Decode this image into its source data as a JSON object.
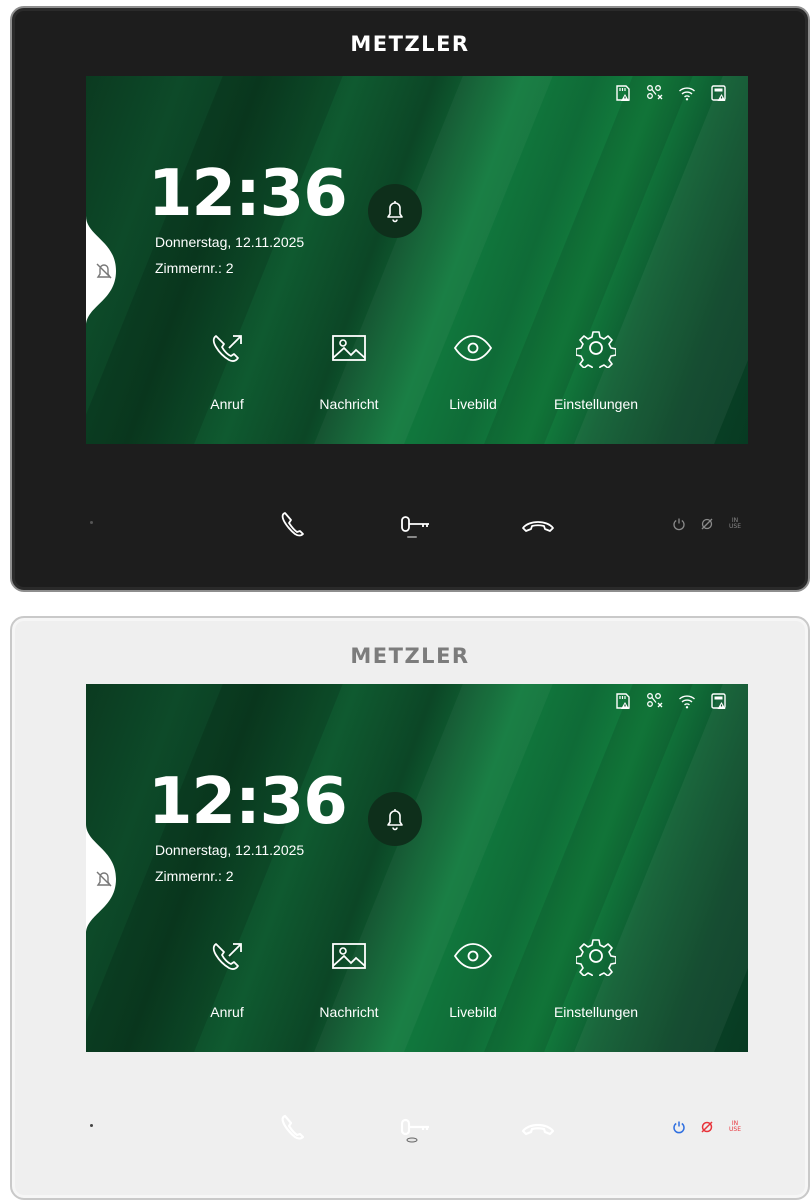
{
  "brand": "METZLER",
  "screen": {
    "time": "12:36",
    "date": "Donnerstag, 12.11.2025",
    "room": "Zimmernr.: 2",
    "status_icons": [
      "sd-card-warning-icon",
      "network-disconnected-icon",
      "wifi-icon",
      "device-warning-icon"
    ],
    "menu": [
      {
        "label": "Anruf",
        "icon": "call-forward-icon"
      },
      {
        "label": "Nachricht",
        "icon": "image-message-icon"
      },
      {
        "label": "Livebild",
        "icon": "eye-icon"
      },
      {
        "label": "Einstellungen",
        "icon": "gear-icon"
      }
    ]
  },
  "hardware_buttons": [
    "phone-icon",
    "key-icon",
    "hang-up-icon"
  ],
  "leds": {
    "inuse_text": "IN\nUSE",
    "inuse_line1": "IN",
    "inuse_line2": "USE"
  },
  "variants": [
    {
      "name": "dark",
      "bezel_color": "#1d1d1d",
      "led_color": "#8a8a8a"
    },
    {
      "name": "light",
      "bezel_color": "#efefef",
      "power_led_color": "#2f6fe0",
      "mute_led_color": "#e8333a"
    }
  ]
}
